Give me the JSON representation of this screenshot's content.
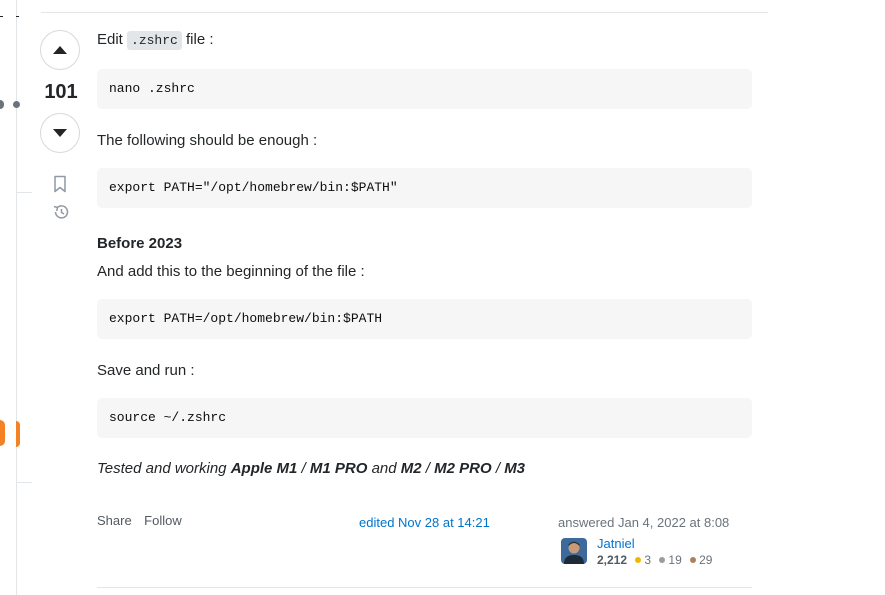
{
  "vote": {
    "count": "101"
  },
  "post": {
    "intro_before": "Edit ",
    "intro_code": ".zshrc",
    "intro_after": " file :",
    "code1": "nano .zshrc",
    "p2": "The following should be enough :",
    "code2": "export PATH=\"/opt/homebrew/bin:$PATH\"",
    "heading": "Before 2023",
    "p3": "And add this to the beginning of the file :",
    "code3": "export PATH=/opt/homebrew/bin:$PATH",
    "p4": "Save and run :",
    "code4": "source ~/.zshrc",
    "tested": {
      "prefix": "Tested and working ",
      "chip1": "Apple M1",
      "sep1": " / ",
      "chip2": "M1 PRO",
      "and": " and ",
      "chip3": "M2",
      "sep2": " / ",
      "chip4": "M2 PRO",
      "sep3": " / ",
      "chip5": "M3"
    }
  },
  "meta": {
    "share": "Share",
    "follow": "Follow",
    "edited": "edited Nov 28 at 14:21",
    "answered": "answered Jan 4, 2022 at 8:08",
    "user_name": "Jatniel",
    "reputation": "2,212",
    "gold": "3",
    "silver": "19",
    "bronze": "29"
  },
  "colors": {
    "link": "#0074cc",
    "gold": "#f1b600",
    "silver": "#9a9c9f",
    "bronze": "#ab825f",
    "accent": "#f48225"
  },
  "icons": {
    "up": "triangle-up",
    "down": "triangle-down",
    "bookmark": "bookmark-icon",
    "history": "history-icon"
  }
}
